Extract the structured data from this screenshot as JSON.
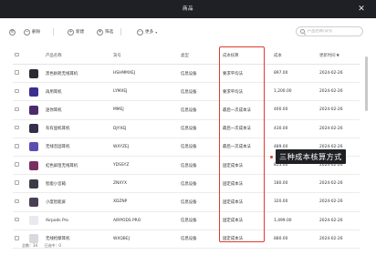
{
  "window": {
    "title": "商品",
    "close_icon": "close-icon"
  },
  "toolbar": {
    "delete_label": "删除",
    "new_label": "新建",
    "filter_label": "筛选",
    "more_label": "更多"
  },
  "search": {
    "placeholder": "产品名称/货号"
  },
  "table": {
    "headers": {
      "name": "产品名称",
      "sku": "货号",
      "type": "类型",
      "cost_method": "成本核算",
      "cost": "成本",
      "updated": "更新时间"
    },
    "rows": [
      {
        "name": "黑色耐耗无线耳机",
        "sku": "HSHMMXEJ",
        "type": "信息设备",
        "cost_method": "要求平均法",
        "cost": "897.00",
        "updated": "2024-02-26",
        "thumb": "#2b2b33"
      },
      {
        "name": "再用耳机",
        "sku": "LYMXEJ",
        "type": "信息设备",
        "cost_method": "要求平均法",
        "cost": "1,200.00",
        "updated": "2024-02-26",
        "thumb": "#3a2f8c"
      },
      {
        "name": "迷你耳机",
        "sku": "MMEJ",
        "type": "信息设备",
        "cost_method": "最后一次成本法",
        "cost": "400.00",
        "updated": "2024-02-26",
        "thumb": "#4b2a6e"
      },
      {
        "name": "有有固机耳机",
        "sku": "DJYXEJ",
        "type": "信息设备",
        "cost_method": "最后一次成本法",
        "cost": "430.00",
        "updated": "2024-02-26",
        "thumb": "#34304a"
      },
      {
        "name": "无线音固耳机",
        "sku": "WXYZEJ",
        "type": "信息设备",
        "cost_method": "最后一次成本法",
        "cost": "489.00",
        "updated": "2024-02-26",
        "thumb": "#5a4fb0"
      },
      {
        "name": "虹色屏阻无线耳机",
        "sku": "YDSSYZ",
        "type": "信息设备",
        "cost_method": "固定成本法",
        "cost": "855.00",
        "updated": "2024-02-26",
        "thumb": "#7a2f63"
      },
      {
        "name": "智能小音箱",
        "sku": "ZNXYX",
        "type": "信息设备",
        "cost_method": "固定成本法",
        "cost": "180.00",
        "updated": "2024-02-26",
        "thumb": "#3c3c46"
      },
      {
        "name": "小度智能屏",
        "sku": "XDZNP",
        "type": "信息设备",
        "cost_method": "固定成本法",
        "cost": "320.00",
        "updated": "2024-02-26",
        "thumb": "#4a3e54"
      },
      {
        "name": "Airpods Pro",
        "sku": "AIRPODS PRO",
        "type": "信息设备",
        "cost_method": "固定成本法",
        "cost": "1,499.00",
        "updated": "2024-02-26",
        "thumb": "#e9e9ee"
      },
      {
        "name": "无线抢摩耳机",
        "sku": "WXQBEJ",
        "type": "信息设备",
        "cost_method": "固定成本法",
        "cost": "880.00",
        "updated": "2024-02-26",
        "thumb": "#d8d8de"
      }
    ]
  },
  "callout": {
    "text": "三种成本核算方式"
  },
  "footer": {
    "total": "总数：34",
    "selected": "已选中：0"
  },
  "colors": {
    "accent": "#e03a2c",
    "titlebar": "#1f2026"
  }
}
